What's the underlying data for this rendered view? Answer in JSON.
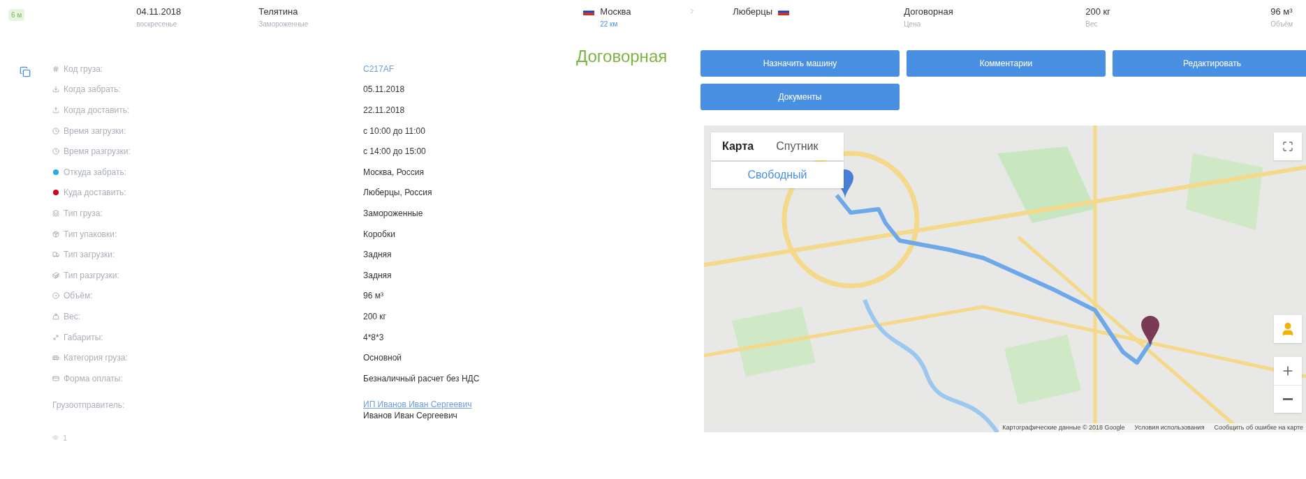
{
  "summary": {
    "age": "6 м",
    "date": "04.11.2018",
    "weekday": "воскресенье",
    "cargo": "Телятина",
    "cargo_type": "Замороженные",
    "from_city": "Москва",
    "distance": "22 км",
    "to_city": "Люберцы",
    "price": "Договорная",
    "price_label": "Цена",
    "weight": "200 кг",
    "weight_label": "Вес",
    "volume": "96 м³",
    "volume_label": "Объём"
  },
  "details": [
    {
      "kind": "icon",
      "label": "Код груза:",
      "value": "C217AF",
      "link": true
    },
    {
      "kind": "icon",
      "label": "Когда забрать:",
      "value": "05.11.2018",
      "link": false
    },
    {
      "kind": "icon",
      "label": "Когда доставить:",
      "value": "22.11.2018",
      "link": false
    },
    {
      "kind": "icon",
      "label": "Время загрузки:",
      "value": "с 10:00 до 11:00",
      "link": false
    },
    {
      "kind": "icon",
      "label": "Время разгрузки:",
      "value": "с 14:00 до 15:00",
      "link": false
    },
    {
      "kind": "dot",
      "color": "#29aae1",
      "label": "Откуда забрать:",
      "value": "Москва, Россия",
      "link": false
    },
    {
      "kind": "dot",
      "color": "#d0021b",
      "label": "Куда доставить:",
      "value": "Люберцы, Россия",
      "link": false
    },
    {
      "kind": "icon",
      "label": "Тип груза:",
      "value": "Замороженные",
      "link": false
    },
    {
      "kind": "icon",
      "label": "Тип упаковки:",
      "value": "Коробки",
      "link": false
    },
    {
      "kind": "icon",
      "label": "Тип загрузки:",
      "value": "Задняя",
      "link": false
    },
    {
      "kind": "icon",
      "label": "Тип разгрузки:",
      "value": "Задняя",
      "link": false
    },
    {
      "kind": "icon",
      "label": "Объём:",
      "value": "96 м³",
      "link": false
    },
    {
      "kind": "icon",
      "label": "Вес:",
      "value": "200 кг",
      "link": false
    },
    {
      "kind": "icon",
      "label": "Габариты:",
      "value": "4*8*3",
      "link": false
    },
    {
      "kind": "icon",
      "label": "Категория груза:",
      "value": "Основной",
      "link": false
    },
    {
      "kind": "icon",
      "label": "Форма оплаты:",
      "value": "Безналичный расчет без НДС",
      "link": false
    }
  ],
  "shipper": {
    "label": "Грузоотправитель:",
    "company": "ИП Иванов Иван Сергеевич",
    "person": "Иванов Иван Сергеевич"
  },
  "views": "1",
  "price_big": "Договорная",
  "buttons": [
    "Назначить машину",
    "Комментарии",
    "Редактировать",
    "Документы"
  ],
  "map": {
    "map_types": [
      {
        "label": "Карта",
        "selected": true
      },
      {
        "label": "Спутник",
        "selected": false
      }
    ],
    "free_button": "Свободный",
    "attribution": [
      "Картографические данные © 2018 Google",
      "Условия использования",
      "Сообщить об ошибке на карте"
    ]
  }
}
